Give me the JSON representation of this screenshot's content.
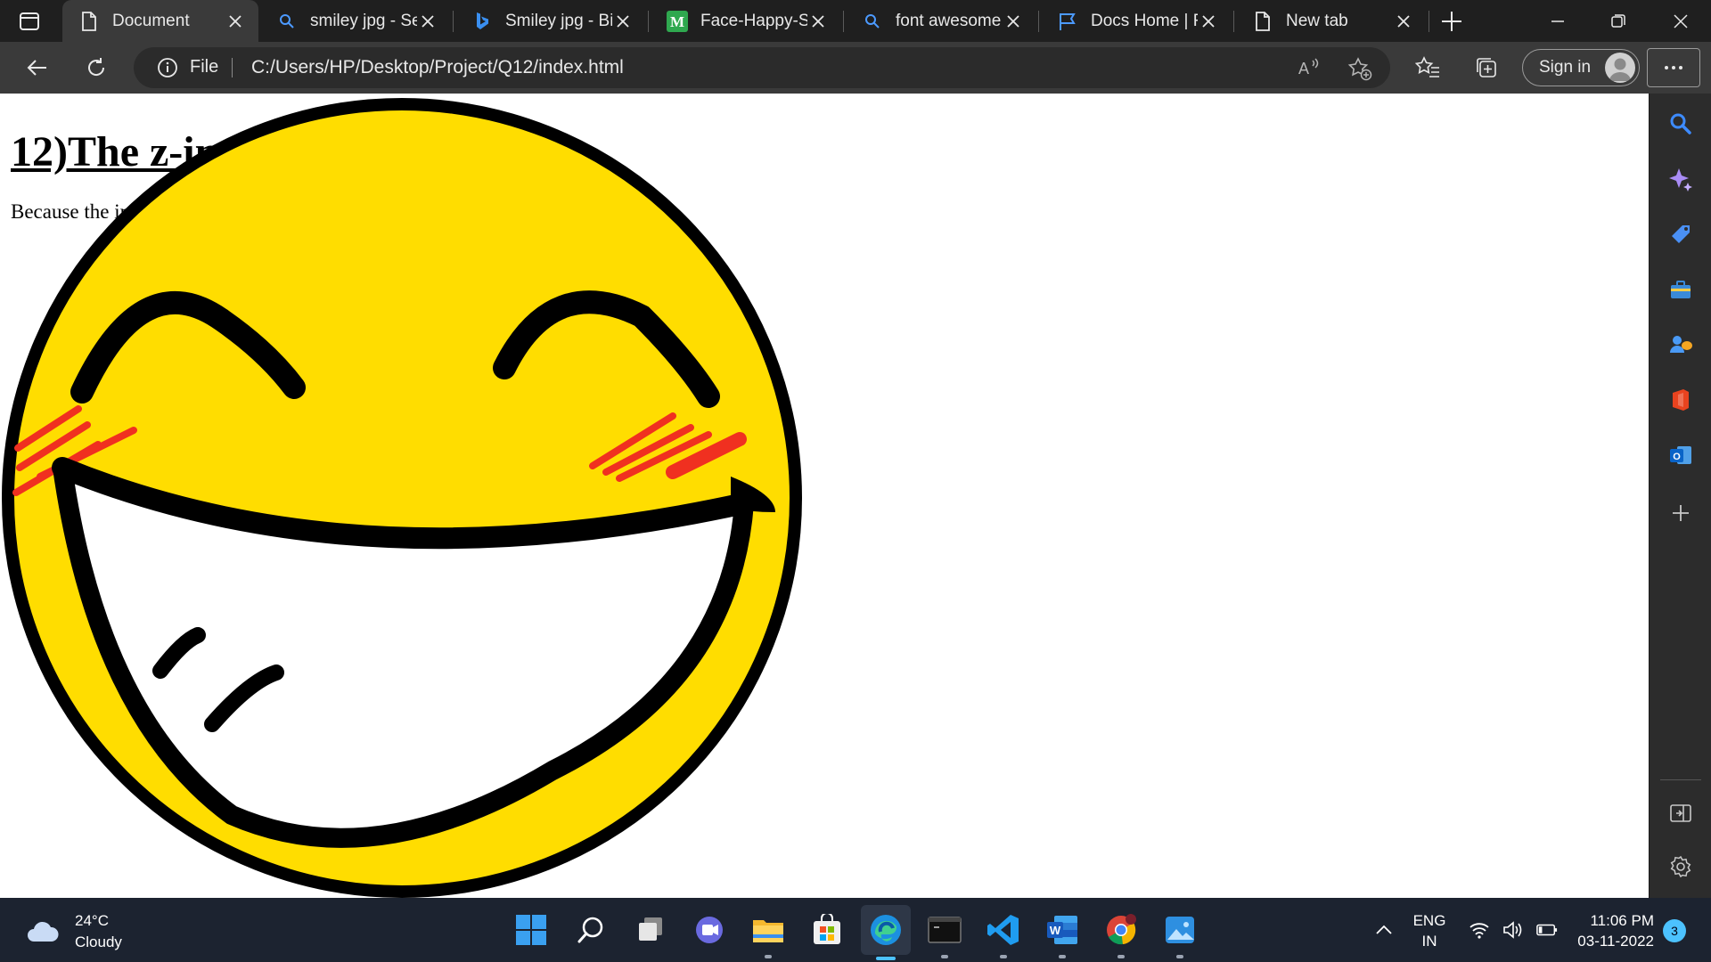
{
  "browser": {
    "tabs": [
      {
        "title": "Document",
        "icon": "page-icon",
        "active": true
      },
      {
        "title": "smiley jpg - Se",
        "icon": "search-icon",
        "active": false
      },
      {
        "title": "Smiley jpg - Bin",
        "icon": "bing-icon",
        "active": false
      },
      {
        "title": "Face-Happy-Sm",
        "icon": "m-logo-icon",
        "active": false
      },
      {
        "title": "font awesome",
        "icon": "search-icon",
        "active": false
      },
      {
        "title": "Docs Home | Fo",
        "icon": "flag-icon",
        "active": false
      },
      {
        "title": "New tab",
        "icon": "page-icon",
        "active": false
      }
    ],
    "address": {
      "scheme_label": "File",
      "url": "C:/Users/HP/Desktop/Project/Q12/index.html"
    },
    "signin_label": "Sign in"
  },
  "page": {
    "heading": "12)The z-index Property",
    "paragraph": "Because the image has a z-index of -1, it will be placed behind the heading.",
    "colors": {
      "smiley_yellow": "#ffdd00",
      "blush_red": "#f03020",
      "outline": "#000000"
    }
  },
  "sidebar": {
    "items": [
      "search-icon",
      "copilot-icon",
      "shopping-tag-icon",
      "tools-icon",
      "games-icon",
      "office-icon",
      "outlook-icon",
      "add-icon",
      "split-screen-icon",
      "settings-icon"
    ]
  },
  "taskbar": {
    "weather": {
      "temp": "24°C",
      "condition": "Cloudy"
    },
    "apps": [
      "windows-start",
      "search",
      "task-view",
      "teams",
      "file-explorer",
      "microsoft-store",
      "edge",
      "terminal",
      "vscode",
      "word",
      "chrome",
      "photos"
    ],
    "language": {
      "line1": "ENG",
      "line2": "IN"
    },
    "clock": {
      "time": "11:06 PM",
      "date": "03-11-2022"
    },
    "notifications": "3"
  }
}
